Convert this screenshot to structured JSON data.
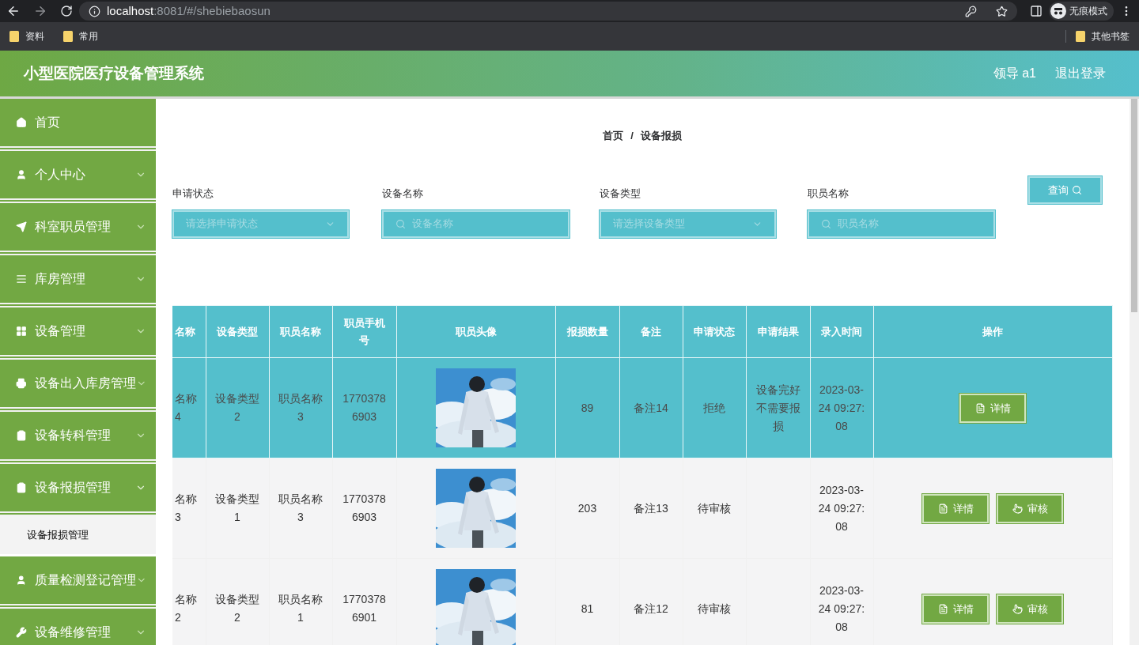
{
  "browser": {
    "url_host": "localhost",
    "url_rest": ":8081/#/shebiebaosun",
    "profile": "无痕模式",
    "bookmarks": [
      "资料",
      "常用"
    ],
    "other_bookmarks": "其他书签"
  },
  "header": {
    "title": "小型医院医疗设备管理系统",
    "user": "领导 a1",
    "logout": "退出登录"
  },
  "sidebar": {
    "items": [
      {
        "label": "首页"
      },
      {
        "label": "个人中心",
        "expanded": false
      },
      {
        "label": "科室职员管理",
        "expanded": false
      },
      {
        "label": "库房管理",
        "expanded": false
      },
      {
        "label": "设备管理",
        "expanded": false
      },
      {
        "label": "设备出入库房管理",
        "expanded": false
      },
      {
        "label": "设备转科管理",
        "expanded": false
      },
      {
        "label": "设备报损管理",
        "expanded": true,
        "children": [
          {
            "label": "设备报损管理"
          }
        ]
      },
      {
        "label": "质量检测登记管理",
        "expanded": false
      },
      {
        "label": "设备维修管理",
        "expanded": false
      }
    ]
  },
  "breadcrumb": [
    "首页",
    "设备报损"
  ],
  "breadcrumb_separator": "/",
  "filters": [
    {
      "kind": "select",
      "label": "申请状态",
      "placeholder": "请选择申请状态"
    },
    {
      "kind": "search",
      "label": "设备名称",
      "placeholder": "设备名称"
    },
    {
      "kind": "select",
      "label": "设备类型",
      "placeholder": "请选择设备类型"
    },
    {
      "kind": "search",
      "label": "职员名称",
      "placeholder": "职员名称"
    }
  ],
  "search_button": "查询",
  "table": {
    "columns": [
      "名称",
      "设备类型",
      "职员名称",
      "职员手机号",
      "职员头像",
      "报损数量",
      "备注",
      "申请状态",
      "申请结果",
      "录入时间",
      "操作"
    ],
    "rows": [
      {
        "selected": true,
        "name": "名称4",
        "type": "设备类型2",
        "staff": "职员名称3",
        "phone": "17703786903",
        "avatar": {
          "kind": "picture"
        },
        "quantity": "89",
        "note": "备注14",
        "status": "拒绝",
        "result": "设备完好不需要报损",
        "time": "2023-03-24 09:27:08",
        "actions": [
          {
            "kind": "detail",
            "label": "详情"
          }
        ]
      },
      {
        "selected": false,
        "name": "名称3",
        "type": "设备类型1",
        "staff": "职员名称3",
        "phone": "17703786903",
        "avatar": {
          "kind": "picture"
        },
        "quantity": "203",
        "note": "备注13",
        "status": "待审核",
        "time": "2023-03-24 09:27:08",
        "actions": [
          {
            "kind": "detail",
            "label": "详情"
          },
          {
            "kind": "review",
            "label": "审核"
          }
        ]
      },
      {
        "selected": false,
        "name": "名称2",
        "type": "设备类型2",
        "staff": "职员名称1",
        "phone": "17703786901",
        "avatar": {
          "kind": "picture"
        },
        "quantity": "81",
        "note": "备注12",
        "status": "待审核",
        "time": "2023-03-24 09:27:08",
        "actions": [
          {
            "kind": "detail",
            "label": "详情"
          },
          {
            "kind": "review",
            "label": "审核"
          }
        ]
      }
    ]
  }
}
